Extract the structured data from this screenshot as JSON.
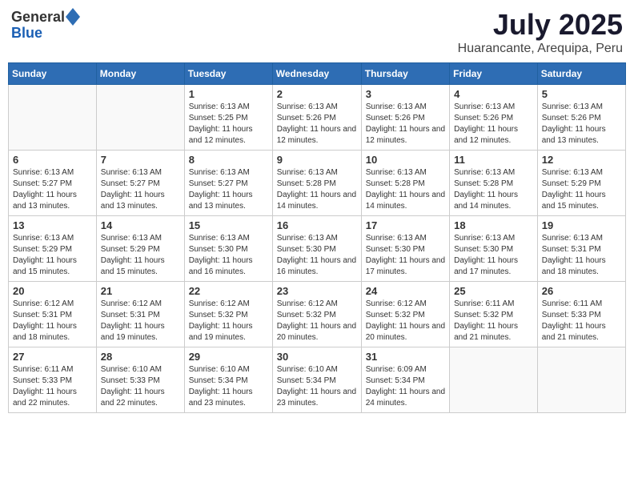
{
  "header": {
    "logo_general": "General",
    "logo_blue": "Blue",
    "month": "July 2025",
    "location": "Huarancante, Arequipa, Peru"
  },
  "weekdays": [
    "Sunday",
    "Monday",
    "Tuesday",
    "Wednesday",
    "Thursday",
    "Friday",
    "Saturday"
  ],
  "weeks": [
    [
      {
        "day": "",
        "sunrise": "",
        "sunset": "",
        "daylight": ""
      },
      {
        "day": "",
        "sunrise": "",
        "sunset": "",
        "daylight": ""
      },
      {
        "day": "1",
        "sunrise": "Sunrise: 6:13 AM",
        "sunset": "Sunset: 5:25 PM",
        "daylight": "Daylight: 11 hours and 12 minutes."
      },
      {
        "day": "2",
        "sunrise": "Sunrise: 6:13 AM",
        "sunset": "Sunset: 5:26 PM",
        "daylight": "Daylight: 11 hours and 12 minutes."
      },
      {
        "day": "3",
        "sunrise": "Sunrise: 6:13 AM",
        "sunset": "Sunset: 5:26 PM",
        "daylight": "Daylight: 11 hours and 12 minutes."
      },
      {
        "day": "4",
        "sunrise": "Sunrise: 6:13 AM",
        "sunset": "Sunset: 5:26 PM",
        "daylight": "Daylight: 11 hours and 12 minutes."
      },
      {
        "day": "5",
        "sunrise": "Sunrise: 6:13 AM",
        "sunset": "Sunset: 5:26 PM",
        "daylight": "Daylight: 11 hours and 13 minutes."
      }
    ],
    [
      {
        "day": "6",
        "sunrise": "Sunrise: 6:13 AM",
        "sunset": "Sunset: 5:27 PM",
        "daylight": "Daylight: 11 hours and 13 minutes."
      },
      {
        "day": "7",
        "sunrise": "Sunrise: 6:13 AM",
        "sunset": "Sunset: 5:27 PM",
        "daylight": "Daylight: 11 hours and 13 minutes."
      },
      {
        "day": "8",
        "sunrise": "Sunrise: 6:13 AM",
        "sunset": "Sunset: 5:27 PM",
        "daylight": "Daylight: 11 hours and 13 minutes."
      },
      {
        "day": "9",
        "sunrise": "Sunrise: 6:13 AM",
        "sunset": "Sunset: 5:28 PM",
        "daylight": "Daylight: 11 hours and 14 minutes."
      },
      {
        "day": "10",
        "sunrise": "Sunrise: 6:13 AM",
        "sunset": "Sunset: 5:28 PM",
        "daylight": "Daylight: 11 hours and 14 minutes."
      },
      {
        "day": "11",
        "sunrise": "Sunrise: 6:13 AM",
        "sunset": "Sunset: 5:28 PM",
        "daylight": "Daylight: 11 hours and 14 minutes."
      },
      {
        "day": "12",
        "sunrise": "Sunrise: 6:13 AM",
        "sunset": "Sunset: 5:29 PM",
        "daylight": "Daylight: 11 hours and 15 minutes."
      }
    ],
    [
      {
        "day": "13",
        "sunrise": "Sunrise: 6:13 AM",
        "sunset": "Sunset: 5:29 PM",
        "daylight": "Daylight: 11 hours and 15 minutes."
      },
      {
        "day": "14",
        "sunrise": "Sunrise: 6:13 AM",
        "sunset": "Sunset: 5:29 PM",
        "daylight": "Daylight: 11 hours and 15 minutes."
      },
      {
        "day": "15",
        "sunrise": "Sunrise: 6:13 AM",
        "sunset": "Sunset: 5:30 PM",
        "daylight": "Daylight: 11 hours and 16 minutes."
      },
      {
        "day": "16",
        "sunrise": "Sunrise: 6:13 AM",
        "sunset": "Sunset: 5:30 PM",
        "daylight": "Daylight: 11 hours and 16 minutes."
      },
      {
        "day": "17",
        "sunrise": "Sunrise: 6:13 AM",
        "sunset": "Sunset: 5:30 PM",
        "daylight": "Daylight: 11 hours and 17 minutes."
      },
      {
        "day": "18",
        "sunrise": "Sunrise: 6:13 AM",
        "sunset": "Sunset: 5:30 PM",
        "daylight": "Daylight: 11 hours and 17 minutes."
      },
      {
        "day": "19",
        "sunrise": "Sunrise: 6:13 AM",
        "sunset": "Sunset: 5:31 PM",
        "daylight": "Daylight: 11 hours and 18 minutes."
      }
    ],
    [
      {
        "day": "20",
        "sunrise": "Sunrise: 6:12 AM",
        "sunset": "Sunset: 5:31 PM",
        "daylight": "Daylight: 11 hours and 18 minutes."
      },
      {
        "day": "21",
        "sunrise": "Sunrise: 6:12 AM",
        "sunset": "Sunset: 5:31 PM",
        "daylight": "Daylight: 11 hours and 19 minutes."
      },
      {
        "day": "22",
        "sunrise": "Sunrise: 6:12 AM",
        "sunset": "Sunset: 5:32 PM",
        "daylight": "Daylight: 11 hours and 19 minutes."
      },
      {
        "day": "23",
        "sunrise": "Sunrise: 6:12 AM",
        "sunset": "Sunset: 5:32 PM",
        "daylight": "Daylight: 11 hours and 20 minutes."
      },
      {
        "day": "24",
        "sunrise": "Sunrise: 6:12 AM",
        "sunset": "Sunset: 5:32 PM",
        "daylight": "Daylight: 11 hours and 20 minutes."
      },
      {
        "day": "25",
        "sunrise": "Sunrise: 6:11 AM",
        "sunset": "Sunset: 5:32 PM",
        "daylight": "Daylight: 11 hours and 21 minutes."
      },
      {
        "day": "26",
        "sunrise": "Sunrise: 6:11 AM",
        "sunset": "Sunset: 5:33 PM",
        "daylight": "Daylight: 11 hours and 21 minutes."
      }
    ],
    [
      {
        "day": "27",
        "sunrise": "Sunrise: 6:11 AM",
        "sunset": "Sunset: 5:33 PM",
        "daylight": "Daylight: 11 hours and 22 minutes."
      },
      {
        "day": "28",
        "sunrise": "Sunrise: 6:10 AM",
        "sunset": "Sunset: 5:33 PM",
        "daylight": "Daylight: 11 hours and 22 minutes."
      },
      {
        "day": "29",
        "sunrise": "Sunrise: 6:10 AM",
        "sunset": "Sunset: 5:34 PM",
        "daylight": "Daylight: 11 hours and 23 minutes."
      },
      {
        "day": "30",
        "sunrise": "Sunrise: 6:10 AM",
        "sunset": "Sunset: 5:34 PM",
        "daylight": "Daylight: 11 hours and 23 minutes."
      },
      {
        "day": "31",
        "sunrise": "Sunrise: 6:09 AM",
        "sunset": "Sunset: 5:34 PM",
        "daylight": "Daylight: 11 hours and 24 minutes."
      },
      {
        "day": "",
        "sunrise": "",
        "sunset": "",
        "daylight": ""
      },
      {
        "day": "",
        "sunrise": "",
        "sunset": "",
        "daylight": ""
      }
    ]
  ]
}
